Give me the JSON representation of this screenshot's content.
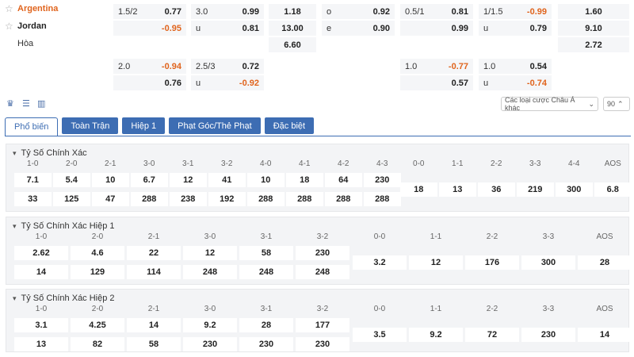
{
  "teams": {
    "home": "Argentina",
    "away": "Jordan",
    "draw": "Hòa"
  },
  "odds_row1": {
    "hdp": {
      "line": "1.5/2",
      "home": "0.77",
      "away": "-0.95"
    },
    "ou": {
      "line": "3.0",
      "over": "0.99",
      "under_label": "u",
      "under": "0.81"
    },
    "x12": {
      "home": "1.18",
      "away": "13.00",
      "draw": "6.60"
    },
    "oe": {
      "odd_label": "o",
      "odd": "0.92",
      "even_label": "e",
      "even": "0.90"
    },
    "hdp1": {
      "line": "0.5/1",
      "home": "0.81",
      "away": "0.99"
    },
    "ou1": {
      "line": "1/1.5",
      "over": "-0.99",
      "under_label": "u",
      "under": "0.79"
    },
    "x12_1": {
      "home": "1.60",
      "away": "9.10",
      "draw": "2.72"
    }
  },
  "odds_row2": {
    "hdp": {
      "line": "2.0",
      "home": "-0.94",
      "away": "0.76"
    },
    "ou": {
      "line": "2.5/3",
      "over": "0.72",
      "under_label": "u",
      "under": "-0.92"
    },
    "hdp1": {
      "line": "1.0",
      "home": "-0.77",
      "away": "0.57"
    },
    "ou1": {
      "line": "1.0",
      "over": "0.54",
      "under_label": "u",
      "under": "-0.74"
    }
  },
  "toolbar": {
    "market_select": "Các loại cược Châu Á khác",
    "minute_select": "90"
  },
  "tabs": [
    "Phổ biến",
    "Toàn Trận",
    "Hiệp 1",
    "Phạt Góc/Thẻ Phạt",
    "Đặc biệt"
  ],
  "sections": [
    {
      "title": "Tỷ Số Chính Xác",
      "left_headers": [
        "1-0",
        "2-0",
        "2-1",
        "3-0",
        "3-1",
        "3-2",
        "4-0",
        "4-1",
        "4-2",
        "4-3"
      ],
      "left_home": [
        "7.1",
        "5.4",
        "10",
        "6.7",
        "12",
        "41",
        "10",
        "18",
        "64",
        "230"
      ],
      "left_away": [
        "33",
        "125",
        "47",
        "288",
        "238",
        "192",
        "288",
        "288",
        "288",
        "288"
      ],
      "right_headers": [
        "0-0",
        "1-1",
        "2-2",
        "3-3",
        "4-4",
        "AOS"
      ],
      "right_values": [
        "18",
        "13",
        "36",
        "219",
        "300",
        "6.8"
      ]
    },
    {
      "title": "Tỷ Số Chính Xác Hiệp 1",
      "left_headers": [
        "1-0",
        "2-0",
        "2-1",
        "3-0",
        "3-1",
        "3-2"
      ],
      "left_home": [
        "2.62",
        "4.6",
        "22",
        "12",
        "58",
        "230"
      ],
      "left_away": [
        "14",
        "129",
        "114",
        "248",
        "248",
        "248"
      ],
      "right_headers": [
        "0-0",
        "1-1",
        "2-2",
        "3-3",
        "AOS"
      ],
      "right_values": [
        "3.2",
        "12",
        "176",
        "300",
        "28"
      ]
    },
    {
      "title": "Tỷ Số Chính Xác Hiệp 2",
      "left_headers": [
        "1-0",
        "2-0",
        "2-1",
        "3-0",
        "3-1",
        "3-2"
      ],
      "left_home": [
        "3.1",
        "4.25",
        "14",
        "9.2",
        "28",
        "177"
      ],
      "left_away": [
        "13",
        "82",
        "58",
        "230",
        "230",
        "230"
      ],
      "right_headers": [
        "0-0",
        "1-1",
        "2-2",
        "3-3",
        "AOS"
      ],
      "right_values": [
        "3.5",
        "9.2",
        "72",
        "230",
        "14"
      ]
    }
  ],
  "colors": {
    "accent": "#3d6db3",
    "negative": "#e0641d"
  }
}
